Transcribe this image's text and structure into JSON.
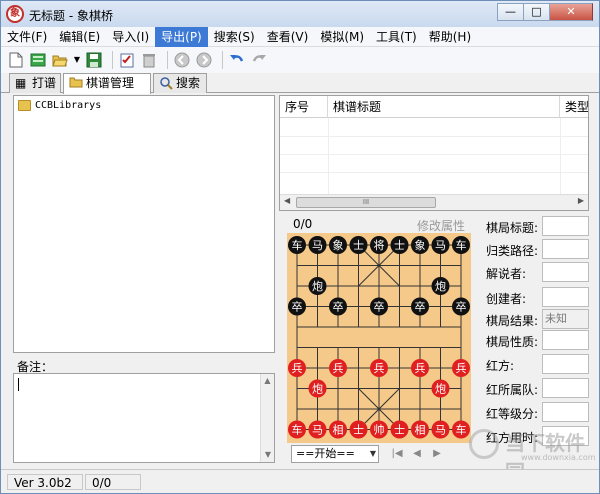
{
  "window": {
    "title": "无标题 - 象棋桥",
    "app_icon_glyph": "象",
    "buttons": {
      "minimize": "—",
      "maximize": "□",
      "close": "✕"
    }
  },
  "menu": [
    {
      "label": "文件(F)"
    },
    {
      "label": "编辑(E)"
    },
    {
      "label": "导入(I)"
    },
    {
      "label": "导出(P)",
      "active": true
    },
    {
      "label": "搜索(S)"
    },
    {
      "label": "查看(V)"
    },
    {
      "label": "模拟(M)"
    },
    {
      "label": "工具(T)"
    },
    {
      "label": "帮助(H)"
    }
  ],
  "toolbar_icons": [
    "new-doc-icon",
    "book-icon",
    "open-folder-icon",
    "save-icon",
    "properties-icon",
    "delete-icon",
    "back-icon",
    "forward-icon",
    "undo-icon",
    "redo-icon"
  ],
  "tabs": [
    {
      "label": "打谱",
      "icon": "board-icon"
    },
    {
      "label": "棋谱管理",
      "icon": "folder-icon",
      "active": true
    },
    {
      "label": "搜索",
      "icon": "magnifier-icon"
    }
  ],
  "tree": {
    "root": "CCBLibrarys"
  },
  "notes": {
    "label": "备注："
  },
  "games_table": {
    "columns": [
      "序号",
      "棋谱标题",
      "类型"
    ],
    "scroll_thumb_text": "III"
  },
  "board": {
    "move_count": "0/0",
    "edit_props": "修改属性",
    "black_pieces": [
      {
        "c": "车",
        "f": 0,
        "r": 0
      },
      {
        "c": "马",
        "f": 1,
        "r": 0
      },
      {
        "c": "象",
        "f": 2,
        "r": 0
      },
      {
        "c": "士",
        "f": 3,
        "r": 0
      },
      {
        "c": "将",
        "f": 4,
        "r": 0
      },
      {
        "c": "士",
        "f": 5,
        "r": 0
      },
      {
        "c": "象",
        "f": 6,
        "r": 0
      },
      {
        "c": "马",
        "f": 7,
        "r": 0
      },
      {
        "c": "车",
        "f": 8,
        "r": 0
      },
      {
        "c": "炮",
        "f": 1,
        "r": 2
      },
      {
        "c": "炮",
        "f": 7,
        "r": 2
      },
      {
        "c": "卒",
        "f": 0,
        "r": 3
      },
      {
        "c": "卒",
        "f": 2,
        "r": 3
      },
      {
        "c": "卒",
        "f": 4,
        "r": 3
      },
      {
        "c": "卒",
        "f": 6,
        "r": 3
      },
      {
        "c": "卒",
        "f": 8,
        "r": 3
      }
    ],
    "red_pieces": [
      {
        "c": "兵",
        "f": 0,
        "r": 6
      },
      {
        "c": "兵",
        "f": 2,
        "r": 6
      },
      {
        "c": "兵",
        "f": 4,
        "r": 6
      },
      {
        "c": "兵",
        "f": 6,
        "r": 6
      },
      {
        "c": "兵",
        "f": 8,
        "r": 6
      },
      {
        "c": "炮",
        "f": 1,
        "r": 7
      },
      {
        "c": "炮",
        "f": 7,
        "r": 7
      },
      {
        "c": "车",
        "f": 0,
        "r": 9
      },
      {
        "c": "马",
        "f": 1,
        "r": 9
      },
      {
        "c": "相",
        "f": 2,
        "r": 9
      },
      {
        "c": "士",
        "f": 3,
        "r": 9
      },
      {
        "c": "帅",
        "f": 4,
        "r": 9
      },
      {
        "c": "士",
        "f": 5,
        "r": 9
      },
      {
        "c": "相",
        "f": 6,
        "r": 9
      },
      {
        "c": "马",
        "f": 7,
        "r": 9
      },
      {
        "c": "车",
        "f": 8,
        "r": 9
      }
    ],
    "colors": {
      "board": "#f5c98a",
      "line": "#333333",
      "black_piece": "#111111",
      "red_piece": "#e02020",
      "piece_text": "#ffffff"
    },
    "start_select": "==开始=="
  },
  "properties": [
    {
      "label": "棋局标题:",
      "value": ""
    },
    {
      "label": "归类路径:",
      "value": ""
    },
    {
      "label": "解说者:",
      "value": ""
    },
    {
      "label": "创建者:",
      "value": ""
    },
    {
      "label": "棋局结果:",
      "value": "未知",
      "readonly": true
    },
    {
      "label": "棋局性质:",
      "value": ""
    },
    {
      "label": "红方:",
      "value": ""
    },
    {
      "label": "红所属队:",
      "value": ""
    },
    {
      "label": "红等级分:",
      "value": ""
    },
    {
      "label": "红方用时:",
      "value": ""
    }
  ],
  "status": {
    "version": "Ver 3.0b2",
    "count": "0/0"
  },
  "watermark": {
    "text": "当下软件园",
    "url": "www.downxia.com"
  }
}
